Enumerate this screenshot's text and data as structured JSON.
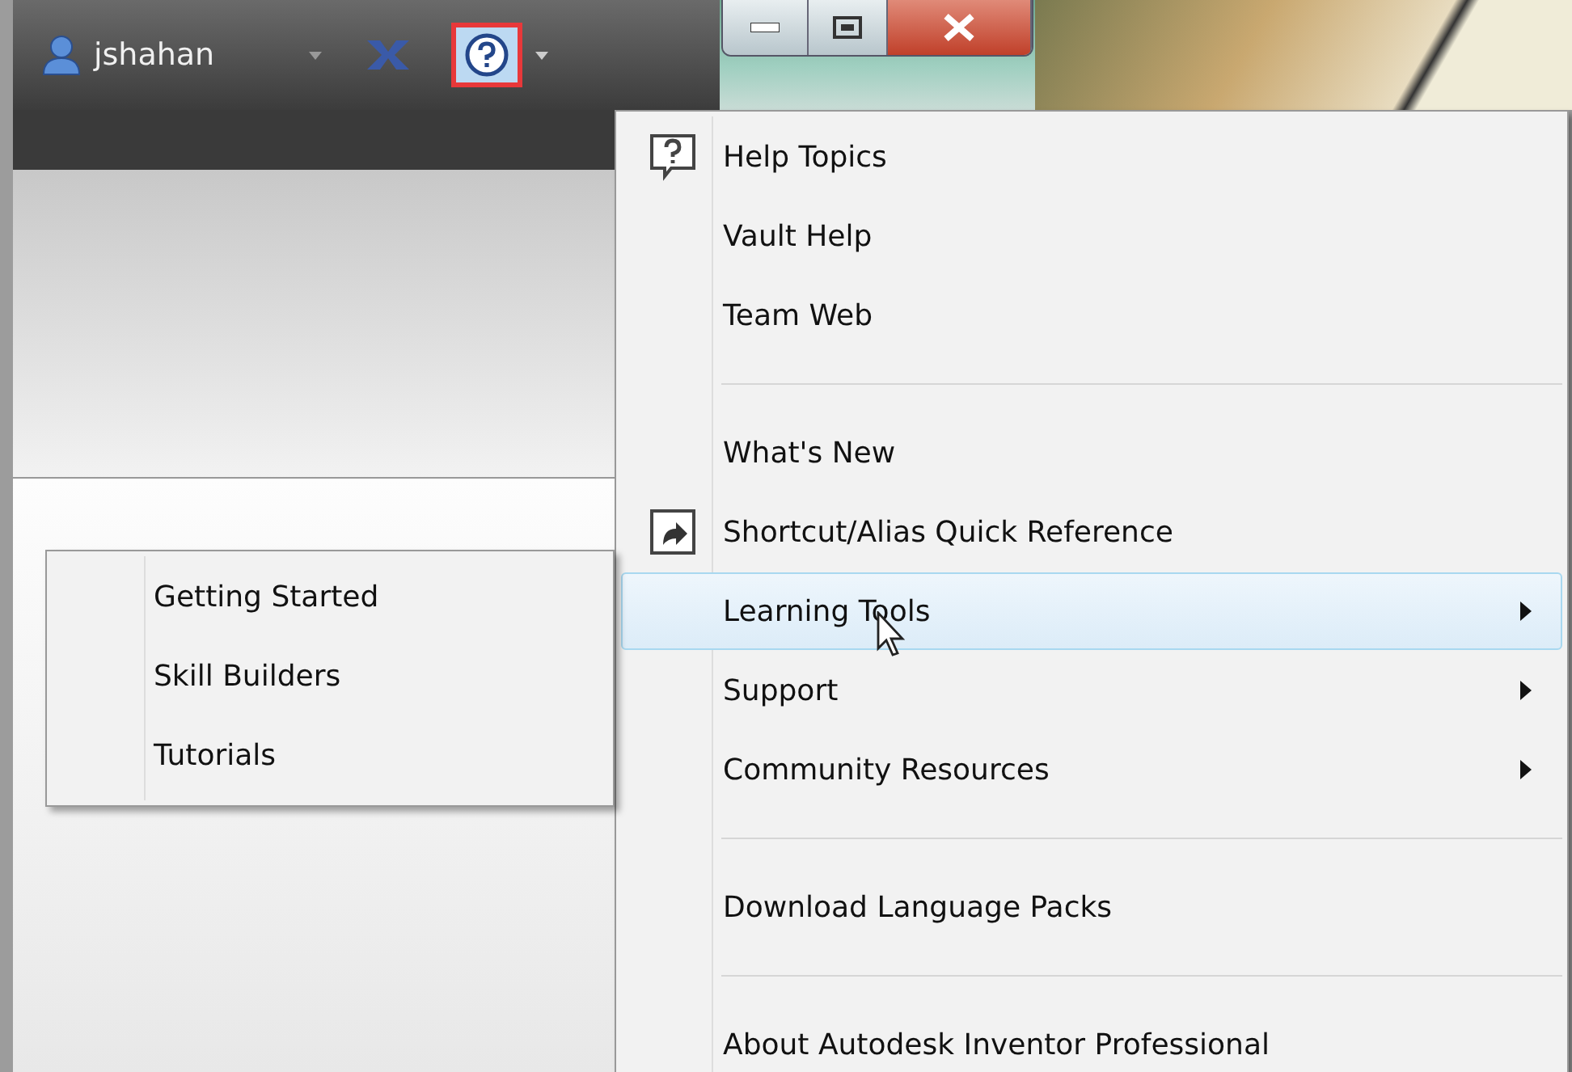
{
  "toolbar": {
    "user": "jshahan",
    "help_button": {
      "highlighted": true,
      "selected": true
    }
  },
  "help_menu": [
    {
      "kind": "help_item",
      "label": "Help Topics",
      "submenu": false,
      "selected": false
    },
    {
      "kind": "item",
      "label": "Vault Help",
      "submenu": false,
      "selected": false
    },
    {
      "kind": "item",
      "label": "Team Web",
      "submenu": false,
      "selected": false
    },
    {
      "kind": "separator"
    },
    {
      "kind": "item",
      "label": "What's New",
      "submenu": false,
      "selected": false
    },
    {
      "kind": "shortcut_item",
      "label": "Shortcut/Alias Quick Reference",
      "submenu": false,
      "selected": false
    },
    {
      "kind": "item",
      "label": "Learning Tools",
      "submenu": true,
      "selected": true
    },
    {
      "kind": "item",
      "label": "Support",
      "submenu": true,
      "selected": false
    },
    {
      "kind": "item",
      "label": "Community Resources",
      "submenu": true,
      "selected": false
    },
    {
      "kind": "separator"
    },
    {
      "kind": "item",
      "label": "Download Language Packs",
      "submenu": false,
      "selected": false
    },
    {
      "kind": "separator"
    },
    {
      "kind": "item",
      "label": "About Autodesk Inventor Professional",
      "submenu": false,
      "selected": false
    }
  ],
  "learning_tools_submenu": [
    {
      "label": "Getting Started",
      "selected": false
    },
    {
      "label": "Skill Builders",
      "selected": false
    },
    {
      "label": "Tutorials",
      "selected": false
    }
  ]
}
